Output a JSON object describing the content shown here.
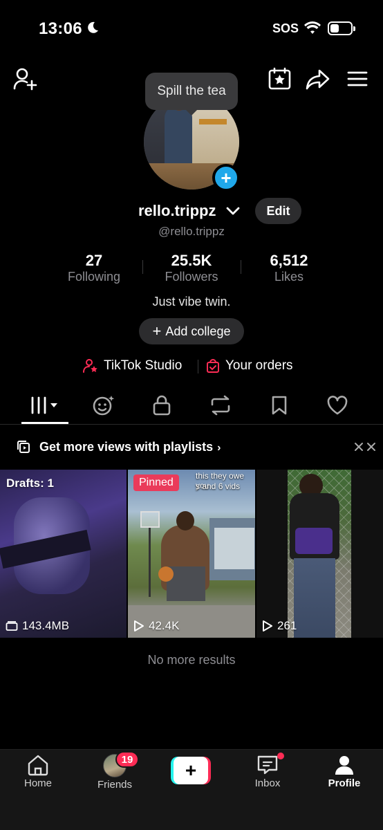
{
  "status_bar": {
    "time": "13:06",
    "sos": "SOS",
    "icons": [
      "moon-icon",
      "wifi-icon",
      "battery-icon"
    ]
  },
  "header": {
    "icons": [
      "add-friend-icon",
      "calendar-star-icon",
      "share-icon",
      "menu-icon"
    ],
    "tooltip": "Spill the tea"
  },
  "profile": {
    "username": "rello.trippz",
    "handle": "@rello.trippz",
    "edit_label": "Edit",
    "stats": [
      {
        "value": "27",
        "label": "Following"
      },
      {
        "value": "25.5K",
        "label": "Followers"
      },
      {
        "value": "6,512",
        "label": "Likes"
      }
    ],
    "bio": "Just vibe twin.",
    "add_college_label": "Add college",
    "links": {
      "studio": "TikTok Studio",
      "orders": "Your orders"
    }
  },
  "tabs": [
    "grid-icon",
    "face-sparkle-icon",
    "lock-icon",
    "repost-icon",
    "bookmark-icon",
    "heart-icon"
  ],
  "promo": {
    "text": "Get more views with playlists",
    "icon": "playlist-icon"
  },
  "videos": [
    {
      "label": "Drafts: 1",
      "stat": "143.4MB",
      "stat_icon": "folder-icon"
    },
    {
      "badge": "Pinned",
      "caption_line1": "this they owe you",
      "caption_line2": "s and 6 vids",
      "stat": "42.4K",
      "stat_icon": "play-icon"
    },
    {
      "stat": "261",
      "stat_icon": "play-icon"
    }
  ],
  "no_more": "No more results",
  "nav": {
    "items": [
      {
        "label": "Home",
        "icon": "home-icon"
      },
      {
        "label": "Friends",
        "icon": "friends-avatar",
        "badge": "19"
      },
      {
        "label": "",
        "icon": "create-icon"
      },
      {
        "label": "Inbox",
        "icon": "inbox-icon"
      },
      {
        "label": "Profile",
        "icon": "profile-icon"
      }
    ]
  },
  "colors": {
    "accent": "#fe2c55",
    "blue": "#20a8ea",
    "muted": "#8e8e93",
    "chip": "#2c2c2e"
  }
}
